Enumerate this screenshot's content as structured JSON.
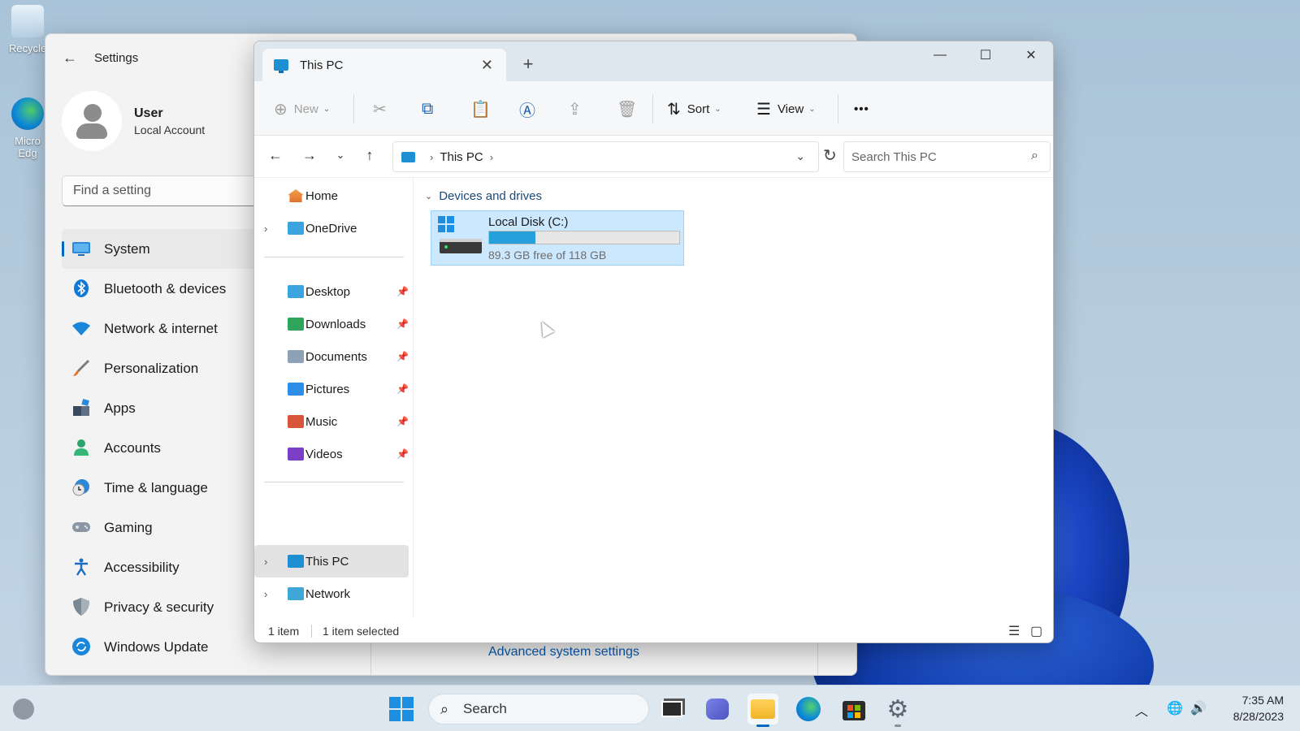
{
  "desktop": {
    "icons": [
      {
        "label": "Recycle"
      },
      {
        "label": "Micro Edg"
      }
    ]
  },
  "settings": {
    "title": "Settings",
    "user_name": "User",
    "account_type": "Local Account",
    "search_placeholder": "Find a setting",
    "nav": [
      {
        "label": "System",
        "icon": "monitor-icon",
        "active": true
      },
      {
        "label": "Bluetooth & devices",
        "icon": "bluetooth-icon"
      },
      {
        "label": "Network & internet",
        "icon": "wifi-icon"
      },
      {
        "label": "Personalization",
        "icon": "brush-icon"
      },
      {
        "label": "Apps",
        "icon": "apps-icon"
      },
      {
        "label": "Accounts",
        "icon": "person-icon"
      },
      {
        "label": "Time & language",
        "icon": "clock-globe-icon"
      },
      {
        "label": "Gaming",
        "icon": "gamepad-icon"
      },
      {
        "label": "Accessibility",
        "icon": "accessibility-icon"
      },
      {
        "label": "Privacy & security",
        "icon": "shield-icon"
      },
      {
        "label": "Windows Update",
        "icon": "update-icon"
      }
    ],
    "bottom_link": "Advanced system settings"
  },
  "explorer": {
    "tab_title": "This PC",
    "toolbar": {
      "new_label": "New",
      "sort_label": "Sort",
      "view_label": "View",
      "more_label": "•••"
    },
    "address": {
      "location": "This PC",
      "search_placeholder": "Search This PC"
    },
    "nav_pane": {
      "top": [
        {
          "label": "Home",
          "expandable": false
        },
        {
          "label": "OneDrive",
          "expandable": true
        }
      ],
      "pinned": [
        {
          "label": "Desktop",
          "color": "#3ba3e0"
        },
        {
          "label": "Downloads",
          "color": "#2fa55b"
        },
        {
          "label": "Documents",
          "color": "#8da2b7"
        },
        {
          "label": "Pictures",
          "color": "#2d8ee8"
        },
        {
          "label": "Music",
          "color": "#d9553a"
        },
        {
          "label": "Videos",
          "color": "#7b3fc7"
        }
      ],
      "bottom": [
        {
          "label": "This PC",
          "selected": true
        },
        {
          "label": "Network",
          "selected": false
        }
      ]
    },
    "group_label": "Devices and drives",
    "drive": {
      "name": "Local Disk (C:)",
      "free_text": "89.3 GB free of 118 GB",
      "used_fraction": 0.243
    },
    "status": {
      "count": "1 item",
      "selected": "1 item selected"
    }
  },
  "taskbar": {
    "search_label": "Search",
    "time": "7:35 AM",
    "date": "8/28/2023"
  },
  "colors": {
    "accent": "#0067c0",
    "selection_bg": "#cce8ff",
    "drive_fill": "#26a0da"
  }
}
